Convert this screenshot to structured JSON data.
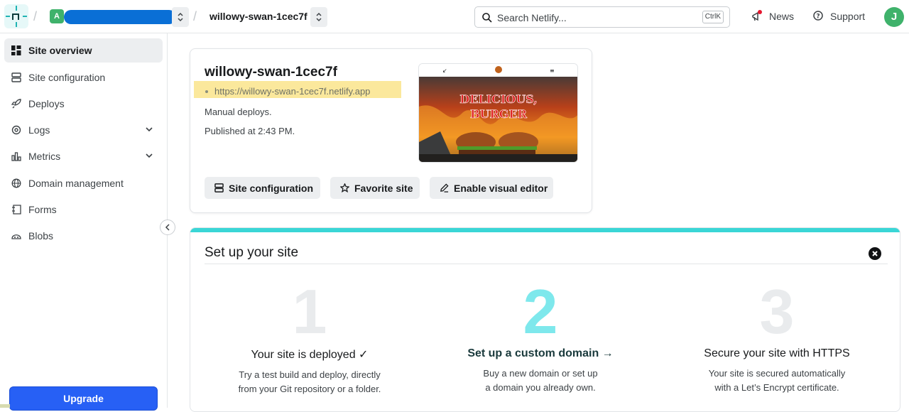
{
  "topbar": {
    "team_initial": "A",
    "site_name": "willowy-swan-1cec7f",
    "search_placeholder": "Search Netlify...",
    "search_shortcut": "CtrlK",
    "news_label": "News",
    "support_label": "Support",
    "user_initial": "J"
  },
  "sidebar": {
    "items": [
      {
        "label": "Site overview",
        "icon": "grid-icon",
        "active": true
      },
      {
        "label": "Site configuration",
        "icon": "server-icon"
      },
      {
        "label": "Deploys",
        "icon": "rocket-icon"
      },
      {
        "label": "Logs",
        "icon": "logs-icon",
        "expandable": true
      },
      {
        "label": "Metrics",
        "icon": "bar-chart-icon",
        "expandable": true
      },
      {
        "label": "Domain management",
        "icon": "globe-icon"
      },
      {
        "label": "Forms",
        "icon": "form-icon"
      },
      {
        "label": "Blobs",
        "icon": "blobs-icon"
      }
    ],
    "upgrade_label": "Upgrade"
  },
  "site_card": {
    "title": "willowy-swan-1cec7f",
    "url": "https://willowy-swan-1cec7f.netlify.app",
    "deploy_mode": "Manual deploys.",
    "published": "Published at 2:43 PM.",
    "preview_text_line1": "DELICIOUS,",
    "preview_text_line2": "BURGER",
    "buttons": {
      "config": "Site configuration",
      "favorite": "Favorite site",
      "visual_editor": "Enable visual editor"
    }
  },
  "setup": {
    "title": "Set up your site",
    "steps": [
      {
        "number": "1",
        "title": "Your site is deployed ✓",
        "desc": "Try a test build and deploy, directly\nfrom your Git repository or a folder."
      },
      {
        "number": "2",
        "title": "Set up a custom domain →",
        "desc": "Buy a new domain or set up\na domain you already own.",
        "active": true
      },
      {
        "number": "3",
        "title": "Secure your site with HTTPS",
        "desc": "Your site is secured automatically\nwith a Let’s Encrypt certificate."
      }
    ]
  },
  "colors": {
    "accent_teal": "#3ad6d6",
    "upgrade_blue": "#2760f5",
    "url_highlight": "#fbe89c"
  }
}
